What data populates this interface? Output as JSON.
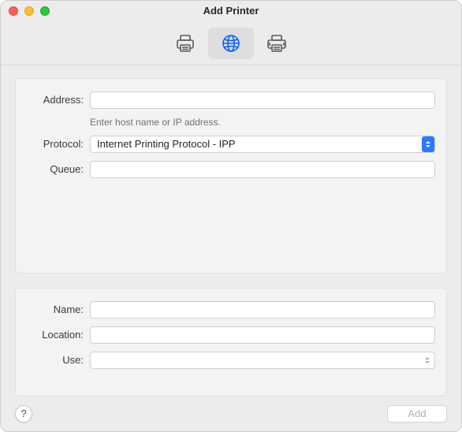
{
  "window": {
    "title": "Add Printer"
  },
  "tabs": {
    "default_icon": "printer-icon",
    "ip_icon": "globe-icon",
    "windows_icon": "printer-advanced-icon",
    "active_index": 1
  },
  "form_top": {
    "address": {
      "label": "Address:",
      "value": "",
      "hint": "Enter host name or IP address."
    },
    "protocol": {
      "label": "Protocol:",
      "value": "Internet Printing Protocol - IPP"
    },
    "queue": {
      "label": "Queue:",
      "value": ""
    }
  },
  "form_bottom": {
    "name": {
      "label": "Name:",
      "value": ""
    },
    "location": {
      "label": "Location:",
      "value": ""
    },
    "use": {
      "label": "Use:",
      "value": ""
    }
  },
  "footer": {
    "help_symbol": "?",
    "add_label": "Add",
    "add_enabled": false
  }
}
